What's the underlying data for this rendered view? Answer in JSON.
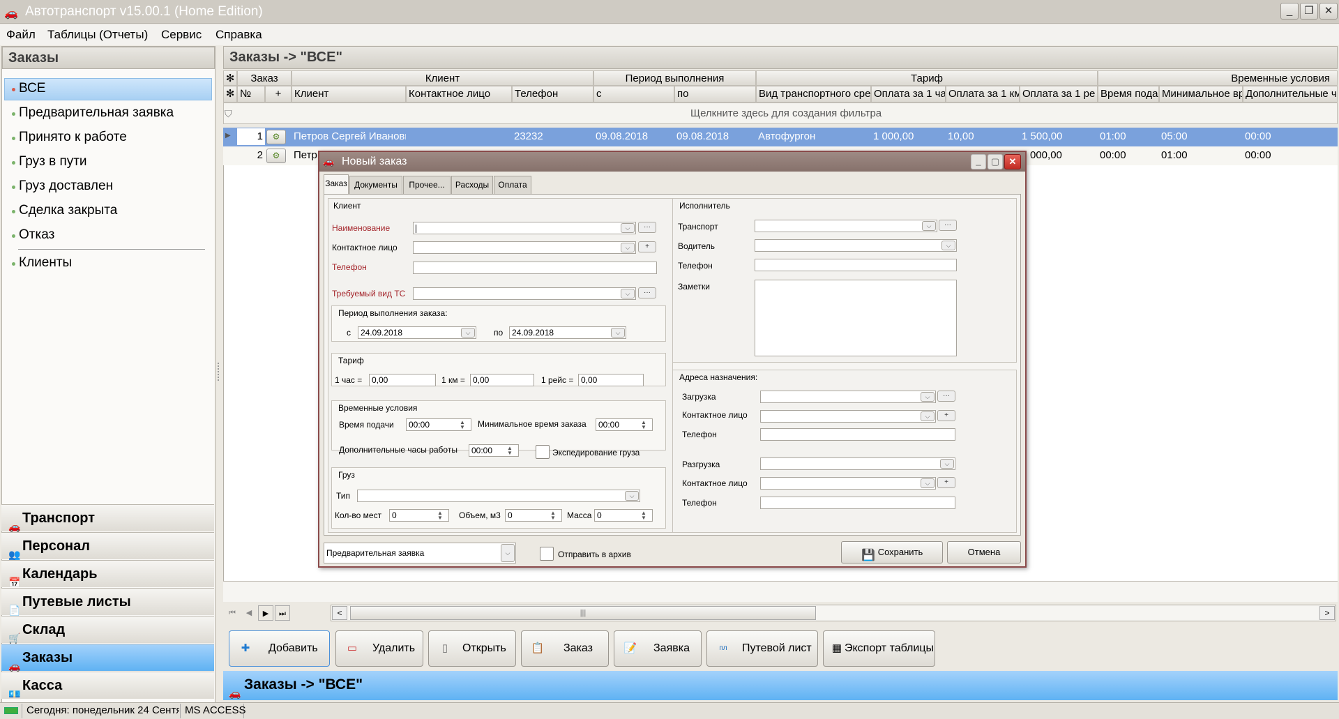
{
  "app": {
    "title": "Автотранспорт v15.00.1 (Home Edition)"
  },
  "menu": [
    "Файл",
    "Таблицы (Отчеты)",
    "Сервис",
    "Справка"
  ],
  "left_panel": {
    "title": "Заказы",
    "items": [
      "ВСЕ",
      "Предварительная заявка",
      "Принято к работе",
      "Груз в пути",
      "Груз доставлен",
      "Сделка закрыта",
      "Отказ",
      "Клиенты"
    ],
    "bottom_nav": [
      "Транспорт",
      "Персонал",
      "Календарь",
      "Путевые листы",
      "Склад",
      "Заказы",
      "Касса"
    ]
  },
  "grid": {
    "title": "Заказы -> \"ВСЕ\"",
    "group_headers": [
      "Заказ",
      "Клиент",
      "Период выполнения",
      "Тариф",
      "Временные условия"
    ],
    "columns": [
      "№",
      "+",
      "Клиент",
      "Контактное лицо",
      "Телефон",
      "с",
      "по",
      "Вид транспортного сре",
      "Оплата за 1 ча",
      "Оплата за 1 км",
      "Оплата за 1 ре",
      "Время подач",
      "Минимальное вр",
      "Дополнительные ча"
    ],
    "filter_hint": "Щелкните здесь для создания фильтра",
    "rows": [
      {
        "num": "1",
        "client": "Петров Сергей Иванови",
        "contact": "",
        "phone": "23232",
        "from": "09.08.2018",
        "to": "09.08.2018",
        "vehicle": "Автофургон",
        "per_hour": "1 000,00",
        "per_km": "10,00",
        "per_trip": "1 500,00",
        "delivery_time": "01:00",
        "min_time": "05:00",
        "extra_hours": "00:00"
      },
      {
        "num": "2",
        "client": "Петр",
        "per_trip": "000,00",
        "delivery_time": "00:00",
        "min_time": "01:00",
        "extra_hours": "00:00"
      }
    ]
  },
  "toolbar": [
    "Добавить",
    "Удалить",
    "Открыть",
    "Заказ",
    "Заявка",
    "Путевой лист",
    "Экспорт таблицы"
  ],
  "bottom_title": "Заказы -> \"ВСЕ\"",
  "status": {
    "date": "Сегодня: понедельник 24 Сентя",
    "db": "MS ACCESS"
  },
  "dialog": {
    "title": "Новый заказ",
    "tabs": [
      "Заказ",
      "Документы",
      "Прочее...",
      "Расходы",
      "Оплата"
    ],
    "client_group": "Клиент",
    "name_label": "Наименование",
    "contact_label": "Контактное лицо",
    "phone_label": "Телефон",
    "vehicle_type_label": "Требуемый вид ТС",
    "period_group": "Период выполнения заказа:",
    "from_label": "с",
    "from_value": "24.09.2018",
    "to_label": "по",
    "to_value": "24.09.2018",
    "tariff_group": "Тариф",
    "hour_label": "1 час =",
    "hour_value": "0,00",
    "km_label": "1 км =",
    "km_value": "0,00",
    "trip_label": "1 рейс =",
    "trip_value": "0,00",
    "time_group": "Временные условия",
    "delivery_label": "Время подачи",
    "delivery_value": "00:00",
    "min_time_label": "Минимальное время заказа",
    "min_time_value": "00:00",
    "extra_label": "Дополнительные часы работы",
    "extra_value": "00:00",
    "forwarding_label": "Экспедирование груза",
    "cargo_group": "Груз",
    "type_label": "Тип",
    "places_label": "Кол-во мест",
    "places_value": "0",
    "volume_label": "Объем, м3",
    "volume_value": "0",
    "mass_label": "Масса",
    "mass_value": "0",
    "executor_group": "Исполнитель",
    "transport_label": "Транспорт",
    "driver_label": "Водитель",
    "exec_phone_label": "Телефон",
    "notes_label": "Заметки",
    "address_group": "Адреса назначения:",
    "loading_label": "Загрузка",
    "load_contact_label": "Контактное лицо",
    "load_phone_label": "Телефон",
    "unloading_label": "Разгрузка",
    "unload_contact_label": "Контактное лицо",
    "unload_phone_label": "Телефон",
    "status_value": "Предварительная заявка",
    "archive_label": "Отправить в архив",
    "save_label": "Сохранить",
    "cancel_label": "Отмена"
  }
}
